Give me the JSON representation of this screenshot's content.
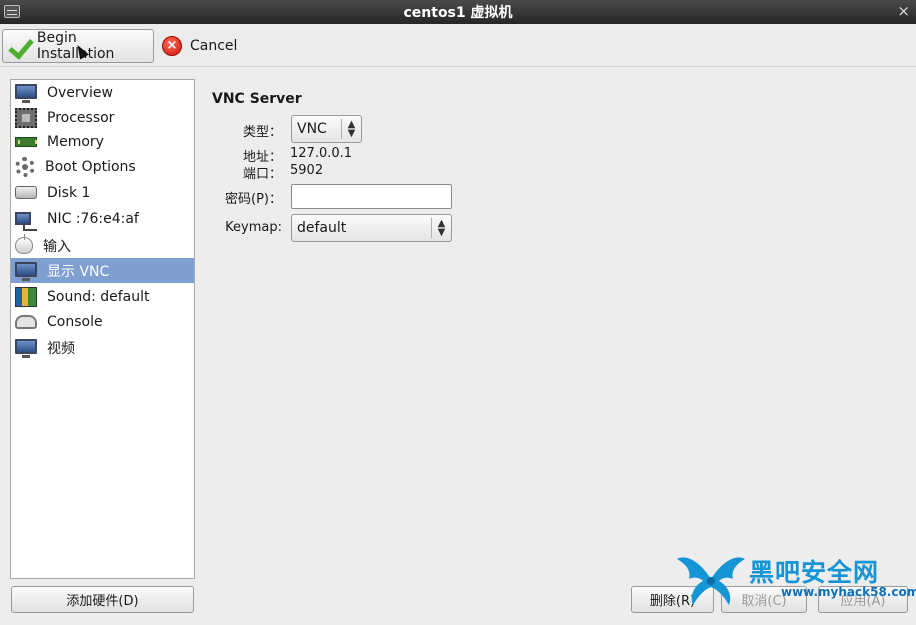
{
  "window": {
    "title": "centos1 虚拟机",
    "close_glyph": "×"
  },
  "toolbar": {
    "begin_label": "Begin Installation",
    "cancel_label": "Cancel"
  },
  "sidebar": {
    "items": [
      {
        "label": "Overview",
        "icon": "monitor-icon"
      },
      {
        "label": "Processor",
        "icon": "cpu-icon"
      },
      {
        "label": "Memory",
        "icon": "memory-icon"
      },
      {
        "label": "Boot Options",
        "icon": "gear-icon"
      },
      {
        "label": "Disk 1",
        "icon": "disk-icon"
      },
      {
        "label": "NIC :76:e4:af",
        "icon": "network-icon"
      },
      {
        "label": "输入",
        "icon": "mouse-icon"
      },
      {
        "label": "显示 VNC",
        "icon": "monitor-icon",
        "selected": true
      },
      {
        "label": "Sound: default",
        "icon": "sound-card-icon"
      },
      {
        "label": "Console",
        "icon": "console-icon"
      },
      {
        "label": "视频",
        "icon": "monitor-icon"
      }
    ],
    "add_hardware_label": "添加硬件(D)"
  },
  "vnc": {
    "section_title": "VNC Server",
    "type_label": "类型：",
    "type_value": "VNC",
    "address_label": "地址：",
    "address_value": "127.0.0.1",
    "port_label": "端口：",
    "port_value": "5902",
    "password_label": "密码(P)：",
    "password_value": "",
    "keymap_label": "Keymap:",
    "keymap_value": "default"
  },
  "footer": {
    "remove_label": "删除(R)",
    "cancel_label": "取消(C)",
    "apply_label": "应用(A)"
  },
  "watermark": {
    "text": "黑吧安全网",
    "url": "www.myhack58.com"
  },
  "colors": {
    "selection": "#7f9fd1",
    "titlebar": "#2e2e2e",
    "watermark": "#1595d6"
  }
}
